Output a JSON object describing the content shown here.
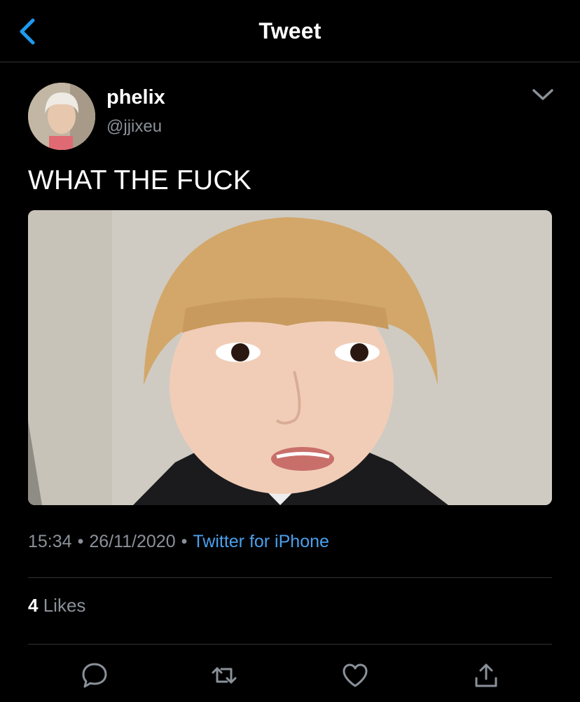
{
  "nav": {
    "title": "Tweet",
    "back_icon": "chevron-left-icon"
  },
  "author": {
    "name": "phelix",
    "handle": "@jjixeu",
    "avatar": "avatar-photo",
    "menu_icon": "chevron-down-icon"
  },
  "tweet": {
    "text": "WHAT THE FUCK",
    "media": "photo"
  },
  "meta": {
    "time": "15:34",
    "separator": "•",
    "date": "26/11/2020",
    "source": "Twitter for iPhone"
  },
  "stats": {
    "likes_count": "4",
    "likes_label": "Likes"
  },
  "actions": {
    "reply_icon": "reply-icon",
    "retweet_icon": "retweet-icon",
    "like_icon": "heart-icon",
    "share_icon": "share-icon"
  },
  "colors": {
    "background": "#000000",
    "text_primary": "#ffffff",
    "text_secondary": "#8a9199",
    "accent": "#1d9bf0",
    "divider": "#2f3336"
  }
}
